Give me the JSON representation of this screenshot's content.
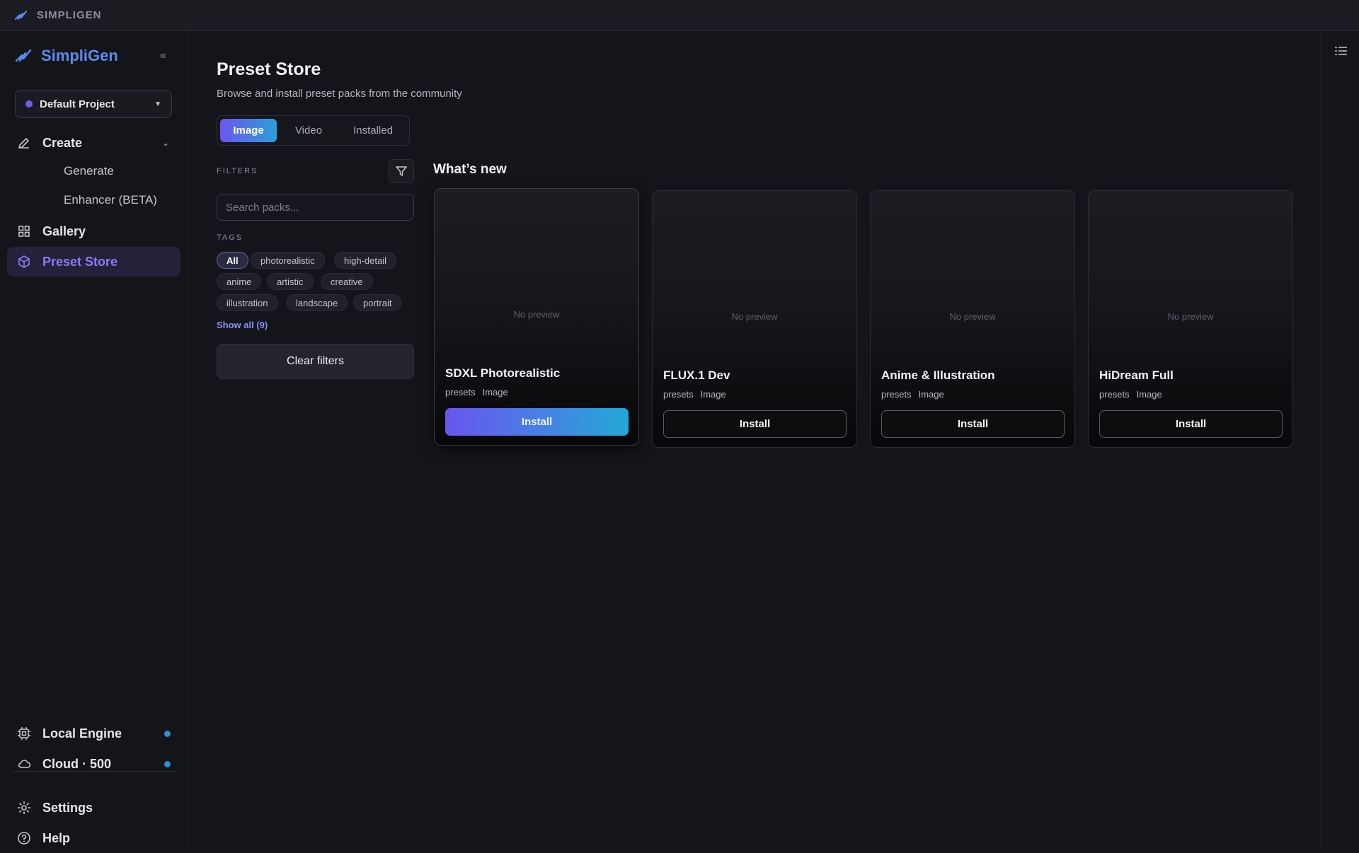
{
  "topbar": {
    "title": "SIMPLIGEN"
  },
  "sidebar": {
    "brand": "SimpliGen",
    "project": "Default Project",
    "nav": {
      "create": "Create",
      "generate": "Generate",
      "enhancer": "Enhancer (BETA)",
      "gallery": "Gallery",
      "preset_store": "Preset Store"
    },
    "bottom": {
      "local_engine": "Local Engine",
      "cloud": "Cloud · 500",
      "settings": "Settings",
      "help": "Help"
    }
  },
  "main": {
    "title": "Preset Store",
    "subtitle": "Browse and install preset packs from the community",
    "tabs": [
      "Image",
      "Video",
      "Installed"
    ],
    "filters_label": "FILTERS",
    "search_placeholder": "Search packs...",
    "tags_label": "TAGS",
    "tags": [
      "All",
      "photorealistic",
      "high-detail",
      "anime",
      "artistic",
      "creative",
      "illustration",
      "landscape",
      "portrait"
    ],
    "show_all": "Show all (9)",
    "clear_filters": "Clear filters",
    "whats_new": "What’s new",
    "cards": [
      {
        "name": "SDXL Photorealistic",
        "kind": "presets",
        "type": "Image",
        "preview": "No preview",
        "install": "Install"
      },
      {
        "name": "FLUX.1 Dev",
        "kind": "presets",
        "type": "Image",
        "preview": "No preview",
        "install": "Install"
      },
      {
        "name": "Anime & Illustration",
        "kind": "presets",
        "type": "Image",
        "preview": "No preview",
        "install": "Install"
      },
      {
        "name": "HiDream Full",
        "kind": "presets",
        "type": "Image",
        "preview": "No preview",
        "install": "Install"
      }
    ]
  },
  "colors": {
    "accent_purple": "#6a55ef",
    "accent_blue": "#25a8d8",
    "brand_blue": "#5b8bf0",
    "status_dot": "#2f8fd8"
  }
}
